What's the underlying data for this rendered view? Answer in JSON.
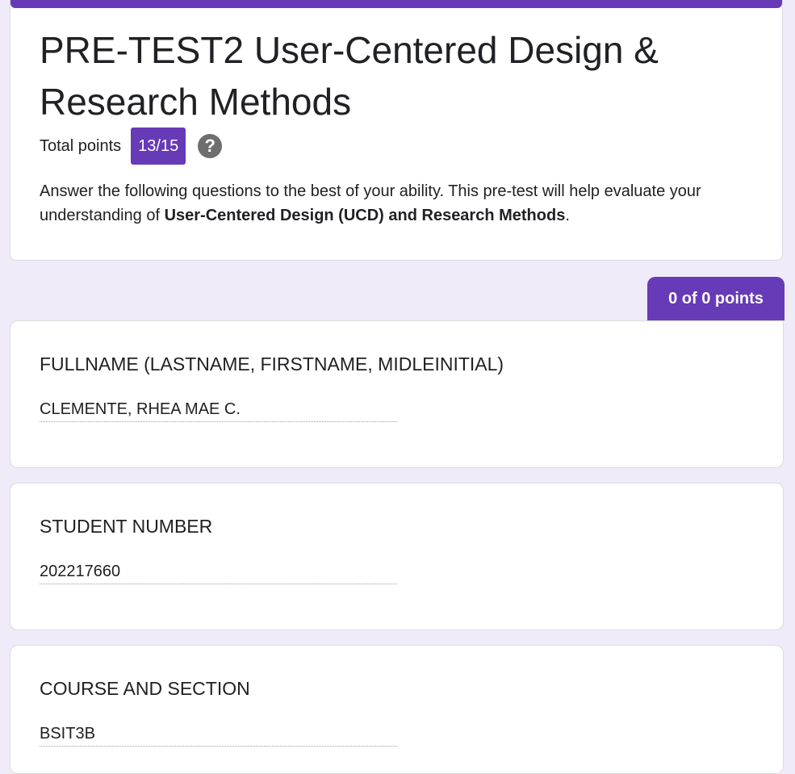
{
  "form": {
    "title": "PRE-TEST2 User-Centered Design & Research Methods",
    "total_points_label": "Total points",
    "score": "13/15",
    "help_icon": "help-circle-icon",
    "description_part1": " Answer the following questions to the best of your ability. This pre-test will help evaluate your understanding of ",
    "description_bold": "User-Centered Design (UCD) and Research Methods",
    "description_part2": "."
  },
  "section": {
    "points_label": "0 of 0 points"
  },
  "questions": [
    {
      "title": "FULLNAME (LASTNAME, FIRSTNAME, MIDLEINITIAL)",
      "answer": "CLEMENTE, RHEA MAE C."
    },
    {
      "title": "STUDENT NUMBER",
      "answer": "202217660"
    },
    {
      "title": "COURSE AND SECTION",
      "answer": "BSIT3B"
    }
  ],
  "colors": {
    "accent": "#673ab7",
    "background": "#f0ebf8"
  }
}
